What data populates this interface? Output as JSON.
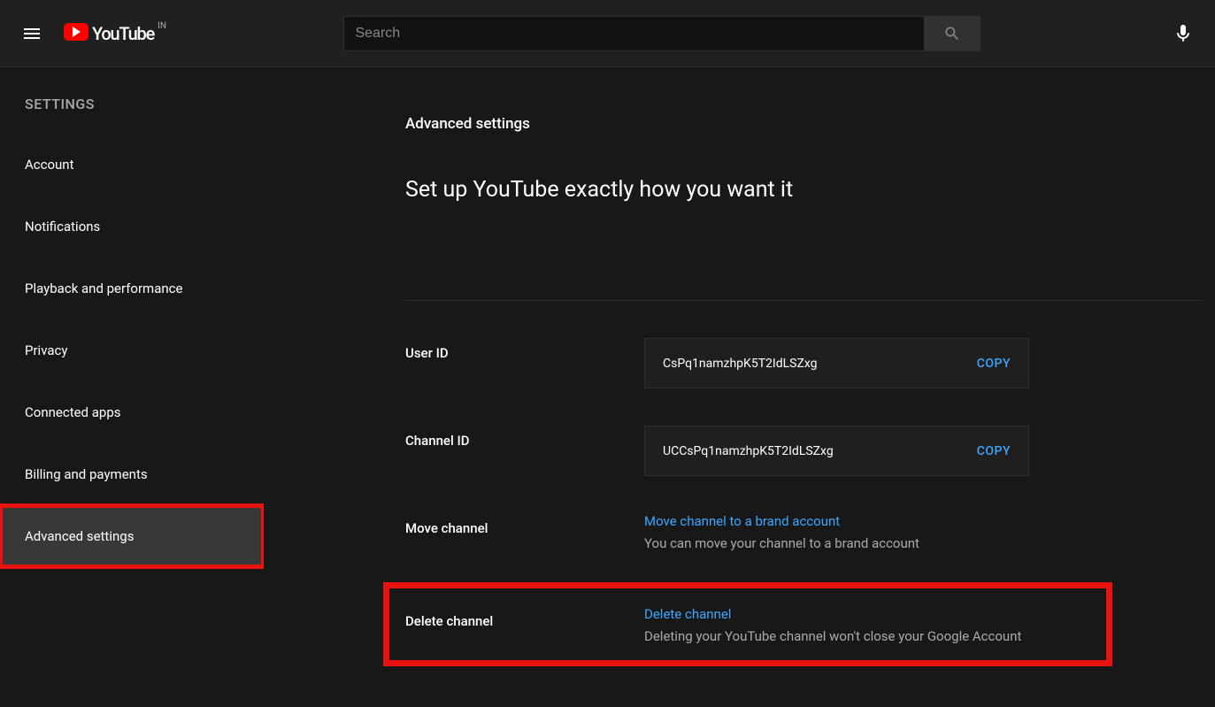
{
  "header": {
    "logo_text": "YouTube",
    "country": "IN",
    "search_placeholder": "Search"
  },
  "sidebar": {
    "title": "SETTINGS",
    "items": [
      {
        "label": "Account"
      },
      {
        "label": "Notifications"
      },
      {
        "label": "Playback and performance"
      },
      {
        "label": "Privacy"
      },
      {
        "label": "Connected apps"
      },
      {
        "label": "Billing and payments"
      },
      {
        "label": "Advanced settings"
      }
    ]
  },
  "main": {
    "title": "Advanced settings",
    "subtitle": "Set up YouTube exactly how you want it",
    "user_id_label": "User ID",
    "user_id_value": "CsPq1namzhpK5T2IdLSZxg",
    "channel_id_label": "Channel ID",
    "channel_id_value": "UCCsPq1namzhpK5T2IdLSZxg",
    "copy_label": "COPY",
    "move_label": "Move channel",
    "move_link": "Move channel to a brand account",
    "move_desc": "You can move your channel to a brand account",
    "delete_label": "Delete channel",
    "delete_link": "Delete channel",
    "delete_desc": "Deleting your YouTube channel won't close your Google Account"
  }
}
